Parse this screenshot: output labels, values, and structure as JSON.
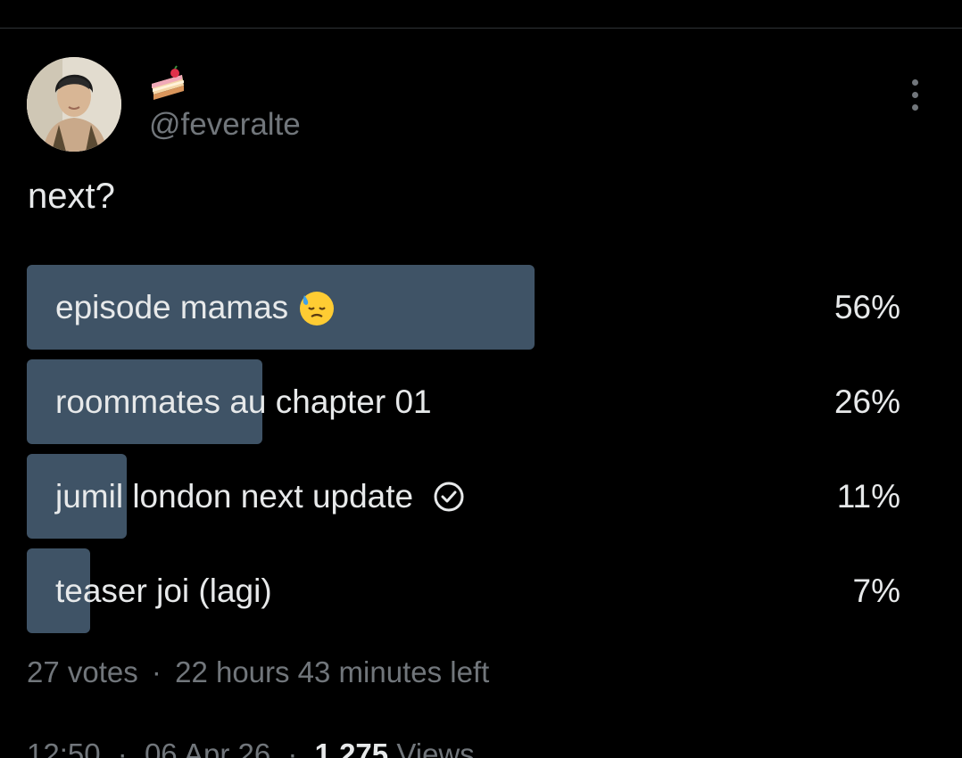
{
  "author": {
    "display_name_icon": "cake-slice-emoji",
    "handle": "@feveralte"
  },
  "tweet": {
    "text": "next?"
  },
  "poll": {
    "options": [
      {
        "label": "episode mamas",
        "emoji": "downcast-sweat-face-emoji",
        "percent_text": "56%",
        "percent": 56,
        "winner": true
      },
      {
        "label": "roommates au chapter 01",
        "percent_text": "26%",
        "percent": 26
      },
      {
        "label": "jumil london next update",
        "voted_icon": "check-circle-icon",
        "percent_text": "11%",
        "percent": 11
      },
      {
        "label": "teaser joi (lagi)",
        "percent_text": "7%",
        "percent": 7
      }
    ],
    "votes": "27 votes",
    "separator": "·",
    "time_left": "22 hours 43 minutes left"
  },
  "meta": {
    "time": "12:50",
    "date": "06 Apr 26",
    "views_count": "1,275",
    "views_label": "Views"
  },
  "colors": {
    "background": "#000000",
    "bar": "#3f5366",
    "text": "#e7e9ea",
    "muted": "#71767b"
  }
}
